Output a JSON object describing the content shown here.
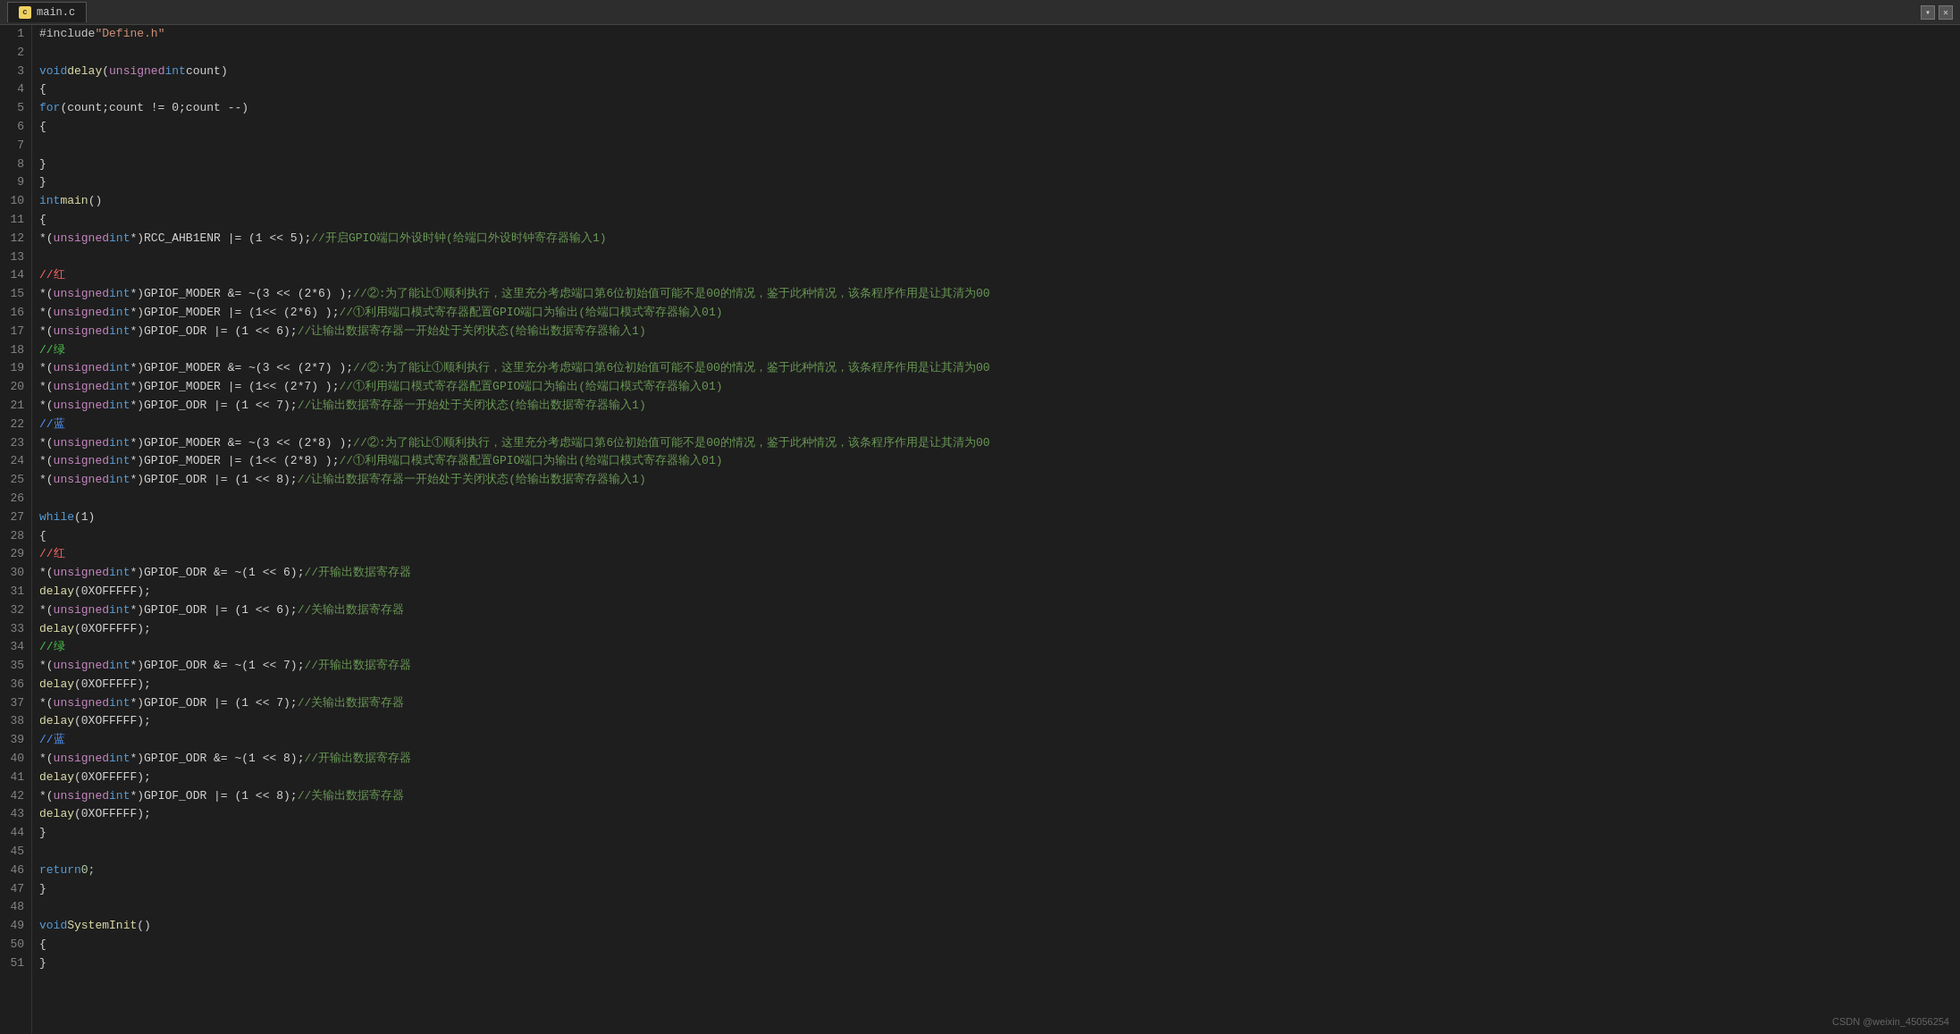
{
  "title_bar": {
    "tab_label": "main.c",
    "minimize_label": "▾",
    "close_label": "✕"
  },
  "watermark": "CSDN @weixin_45056254",
  "lines": [
    {
      "num": 1,
      "tokens": [
        {
          "t": "#include ",
          "c": "macro"
        },
        {
          "t": "\"Define.h\"",
          "c": "include-path"
        }
      ]
    },
    {
      "num": 2,
      "tokens": []
    },
    {
      "num": 3,
      "tokens": [
        {
          "t": "void ",
          "c": "kw"
        },
        {
          "t": "delay",
          "c": "fn"
        },
        {
          "t": "(",
          "c": "punct"
        },
        {
          "t": "unsigned ",
          "c": "kw2"
        },
        {
          "t": "int ",
          "c": "kw"
        },
        {
          "t": "count)",
          "c": "plain"
        }
      ]
    },
    {
      "num": 4,
      "tokens": [
        {
          "t": "{",
          "c": "punct"
        }
      ]
    },
    {
      "num": 5,
      "tokens": [
        {
          "t": "    ",
          "c": "plain"
        },
        {
          "t": "for",
          "c": "kw"
        },
        {
          "t": "(count;count != 0;count --)",
          "c": "plain"
        }
      ]
    },
    {
      "num": 6,
      "tokens": [
        {
          "t": "    {",
          "c": "punct"
        }
      ]
    },
    {
      "num": 7,
      "tokens": []
    },
    {
      "num": 8,
      "tokens": [
        {
          "t": "    }",
          "c": "punct"
        }
      ]
    },
    {
      "num": 9,
      "tokens": [
        {
          "t": "}",
          "c": "punct"
        }
      ]
    },
    {
      "num": 10,
      "tokens": [
        {
          "t": "int ",
          "c": "kw"
        },
        {
          "t": "main",
          "c": "fn"
        },
        {
          "t": "()",
          "c": "plain"
        }
      ]
    },
    {
      "num": 11,
      "tokens": [
        {
          "t": "{",
          "c": "punct"
        }
      ]
    },
    {
      "num": 12,
      "tokens": [
        {
          "t": "    *(",
          "c": "plain"
        },
        {
          "t": "unsigned ",
          "c": "kw2"
        },
        {
          "t": "int ",
          "c": "kw"
        },
        {
          "t": "*)RCC_AHB1ENR |= (1 << 5);",
          "c": "plain"
        },
        {
          "t": "//开启GPIO端口外设时钟(给端口外设时钟寄存器输入1)",
          "c": "comment"
        }
      ]
    },
    {
      "num": 13,
      "tokens": []
    },
    {
      "num": 14,
      "tokens": [
        {
          "t": "    //红",
          "c": "comment-red"
        }
      ]
    },
    {
      "num": 15,
      "tokens": [
        {
          "t": "    *(",
          "c": "plain"
        },
        {
          "t": "unsigned ",
          "c": "kw2"
        },
        {
          "t": "int ",
          "c": "kw"
        },
        {
          "t": "*)GPIOF_MODER &= ~(3 << (2*6) );",
          "c": "plain"
        },
        {
          "t": "//②:为了能让①顺利执行，这里充分考虑端口第6位初始值可能不是00的情况，鉴于此种情况，该条程序作用是让其清为00",
          "c": "comment"
        }
      ]
    },
    {
      "num": 16,
      "tokens": [
        {
          "t": "    *(",
          "c": "plain"
        },
        {
          "t": "unsigned ",
          "c": "kw2"
        },
        {
          "t": "int ",
          "c": "kw"
        },
        {
          "t": "*)GPIOF_MODER |= (1<< (2*6) );",
          "c": "plain"
        },
        {
          "t": "//①利用端口模式寄存器配置GPIO端口为输出(给端口模式寄存器输入01)",
          "c": "comment"
        }
      ]
    },
    {
      "num": 17,
      "tokens": [
        {
          "t": "    *(",
          "c": "plain"
        },
        {
          "t": "unsigned ",
          "c": "kw2"
        },
        {
          "t": "int ",
          "c": "kw"
        },
        {
          "t": "*)GPIOF_ODR |= (1 << 6);",
          "c": "plain"
        },
        {
          "t": "//让输出数据寄存器一开始处于关闭状态(给输出数据寄存器输入1)",
          "c": "comment"
        }
      ]
    },
    {
      "num": 18,
      "tokens": [
        {
          "t": "    //绿",
          "c": "comment-green"
        }
      ]
    },
    {
      "num": 19,
      "tokens": [
        {
          "t": "    *(",
          "c": "plain"
        },
        {
          "t": "unsigned ",
          "c": "kw2"
        },
        {
          "t": "int ",
          "c": "kw"
        },
        {
          "t": "*)GPIOF_MODER &= ~(3 << (2*7) );",
          "c": "plain"
        },
        {
          "t": "//②:为了能让①顺利执行，这里充分考虑端口第6位初始值可能不是00的情况，鉴于此种情况，该条程序作用是让其清为00",
          "c": "comment"
        }
      ]
    },
    {
      "num": 20,
      "tokens": [
        {
          "t": "    *(",
          "c": "plain"
        },
        {
          "t": "unsigned ",
          "c": "kw2"
        },
        {
          "t": "int ",
          "c": "kw"
        },
        {
          "t": "*)GPIOF_MODER |= (1<< (2*7) );",
          "c": "plain"
        },
        {
          "t": "//①利用端口模式寄存器配置GPIO端口为输出(给端口模式寄存器输入01)",
          "c": "comment"
        }
      ]
    },
    {
      "num": 21,
      "tokens": [
        {
          "t": "    *(",
          "c": "plain"
        },
        {
          "t": "unsigned ",
          "c": "kw2"
        },
        {
          "t": "int ",
          "c": "kw"
        },
        {
          "t": "*)GPIOF_ODR |= (1 << 7);",
          "c": "plain"
        },
        {
          "t": "//让输出数据寄存器一开始处于关闭状态(给输出数据寄存器输入1)",
          "c": "comment"
        }
      ]
    },
    {
      "num": 22,
      "tokens": [
        {
          "t": "    //蓝",
          "c": "comment-blue"
        }
      ]
    },
    {
      "num": 23,
      "tokens": [
        {
          "t": "    *(",
          "c": "plain"
        },
        {
          "t": "unsigned ",
          "c": "kw2"
        },
        {
          "t": "int ",
          "c": "kw"
        },
        {
          "t": "*)GPIOF_MODER &= ~(3 << (2*8) );",
          "c": "plain"
        },
        {
          "t": "//②:为了能让①顺利执行，这里充分考虑端口第6位初始值可能不是00的情况，鉴于此种情况，该条程序作用是让其清为00",
          "c": "comment"
        }
      ]
    },
    {
      "num": 24,
      "tokens": [
        {
          "t": "    *(",
          "c": "plain"
        },
        {
          "t": "unsigned ",
          "c": "kw2"
        },
        {
          "t": "int ",
          "c": "kw"
        },
        {
          "t": "*)GPIOF_MODER |= (1<< (2*8) );",
          "c": "plain"
        },
        {
          "t": "//①利用端口模式寄存器配置GPIO端口为输出(给端口模式寄存器输入01)",
          "c": "comment"
        }
      ]
    },
    {
      "num": 25,
      "tokens": [
        {
          "t": "    *(",
          "c": "plain"
        },
        {
          "t": "unsigned ",
          "c": "kw2"
        },
        {
          "t": "int ",
          "c": "kw"
        },
        {
          "t": "*)GPIOF_ODR |= (1 << 8);",
          "c": "plain"
        },
        {
          "t": "//让输出数据寄存器一开始处于关闭状态(给输出数据寄存器输入1)",
          "c": "comment"
        }
      ]
    },
    {
      "num": 26,
      "tokens": []
    },
    {
      "num": 27,
      "tokens": [
        {
          "t": "    ",
          "c": "plain"
        },
        {
          "t": "while",
          "c": "kw"
        },
        {
          "t": "(1)",
          "c": "plain"
        }
      ]
    },
    {
      "num": 28,
      "tokens": [
        {
          "t": "    {",
          "c": "punct"
        }
      ]
    },
    {
      "num": 29,
      "tokens": [
        {
          "t": "        //红",
          "c": "comment-red"
        }
      ]
    },
    {
      "num": 30,
      "tokens": [
        {
          "t": "        *(",
          "c": "plain"
        },
        {
          "t": "unsigned ",
          "c": "kw2"
        },
        {
          "t": "int ",
          "c": "kw"
        },
        {
          "t": "*)GPIOF_ODR &= ~(1 << 6);",
          "c": "plain"
        },
        {
          "t": "//开输出数据寄存器",
          "c": "comment"
        }
      ]
    },
    {
      "num": 31,
      "tokens": [
        {
          "t": "        ",
          "c": "plain"
        },
        {
          "t": "delay",
          "c": "fn"
        },
        {
          "t": "(0XOFFFFF);",
          "c": "plain"
        }
      ]
    },
    {
      "num": 32,
      "tokens": [
        {
          "t": "        *(",
          "c": "plain"
        },
        {
          "t": "unsigned ",
          "c": "kw2"
        },
        {
          "t": "int ",
          "c": "kw"
        },
        {
          "t": "*)GPIOF_ODR |= (1 << 6);",
          "c": "plain"
        },
        {
          "t": "//关输出数据寄存器",
          "c": "comment"
        }
      ]
    },
    {
      "num": 33,
      "tokens": [
        {
          "t": "        ",
          "c": "plain"
        },
        {
          "t": "delay",
          "c": "fn"
        },
        {
          "t": "(0XOFFFFF);",
          "c": "plain"
        }
      ]
    },
    {
      "num": 34,
      "tokens": [
        {
          "t": "        //绿",
          "c": "comment-green"
        }
      ]
    },
    {
      "num": 35,
      "tokens": [
        {
          "t": "        *(",
          "c": "plain"
        },
        {
          "t": "unsigned ",
          "c": "kw2"
        },
        {
          "t": "int ",
          "c": "kw"
        },
        {
          "t": "*)GPIOF_ODR &= ~(1 << 7);",
          "c": "plain"
        },
        {
          "t": "//开输出数据寄存器",
          "c": "comment"
        }
      ]
    },
    {
      "num": 36,
      "tokens": [
        {
          "t": "        ",
          "c": "plain"
        },
        {
          "t": "delay",
          "c": "fn"
        },
        {
          "t": "(0XOFFFFF);",
          "c": "plain"
        }
      ]
    },
    {
      "num": 37,
      "tokens": [
        {
          "t": "        *(",
          "c": "plain"
        },
        {
          "t": "unsigned ",
          "c": "kw2"
        },
        {
          "t": "int ",
          "c": "kw"
        },
        {
          "t": "*)GPIOF_ODR |= (1 << 7);",
          "c": "plain"
        },
        {
          "t": "//关输出数据寄存器",
          "c": "comment"
        }
      ]
    },
    {
      "num": 38,
      "tokens": [
        {
          "t": "        ",
          "c": "plain"
        },
        {
          "t": "delay",
          "c": "fn"
        },
        {
          "t": "(0XOFFFFF);",
          "c": "plain"
        }
      ]
    },
    {
      "num": 39,
      "tokens": [
        {
          "t": "        //蓝",
          "c": "comment-blue"
        }
      ]
    },
    {
      "num": 40,
      "tokens": [
        {
          "t": "        *(",
          "c": "plain"
        },
        {
          "t": "unsigned ",
          "c": "kw2"
        },
        {
          "t": "int ",
          "c": "kw"
        },
        {
          "t": "*)GPIOF_ODR &= ~(1 << 8);",
          "c": "plain"
        },
        {
          "t": "//开输出数据寄存器",
          "c": "comment"
        }
      ]
    },
    {
      "num": 41,
      "tokens": [
        {
          "t": "        ",
          "c": "plain"
        },
        {
          "t": "delay",
          "c": "fn"
        },
        {
          "t": "(0XOFFFFF);",
          "c": "plain"
        }
      ]
    },
    {
      "num": 42,
      "tokens": [
        {
          "t": "        *(",
          "c": "plain"
        },
        {
          "t": "unsigned ",
          "c": "kw2"
        },
        {
          "t": "int ",
          "c": "kw"
        },
        {
          "t": "*)GPIOF_ODR |= (1 << 8);",
          "c": "plain"
        },
        {
          "t": "//关输出数据寄存器",
          "c": "comment"
        }
      ]
    },
    {
      "num": 43,
      "tokens": [
        {
          "t": "        ",
          "c": "plain"
        },
        {
          "t": "delay",
          "c": "fn"
        },
        {
          "t": "(0XOFFFFF);",
          "c": "plain"
        }
      ]
    },
    {
      "num": 44,
      "tokens": [
        {
          "t": "    }",
          "c": "punct"
        }
      ]
    },
    {
      "num": 45,
      "tokens": []
    },
    {
      "num": 46,
      "tokens": [
        {
          "t": "    ",
          "c": "plain"
        },
        {
          "t": "return ",
          "c": "kw"
        },
        {
          "t": "0;",
          "c": "num"
        }
      ]
    },
    {
      "num": 47,
      "tokens": [
        {
          "t": "}",
          "c": "punct"
        }
      ]
    },
    {
      "num": 48,
      "tokens": []
    },
    {
      "num": 49,
      "tokens": [
        {
          "t": "void ",
          "c": "kw"
        },
        {
          "t": "SystemInit",
          "c": "fn"
        },
        {
          "t": "()",
          "c": "plain"
        }
      ]
    },
    {
      "num": 50,
      "tokens": [
        {
          "t": "{",
          "c": "punct"
        }
      ]
    },
    {
      "num": 51,
      "tokens": [
        {
          "t": "}",
          "c": "punct"
        }
      ]
    }
  ]
}
